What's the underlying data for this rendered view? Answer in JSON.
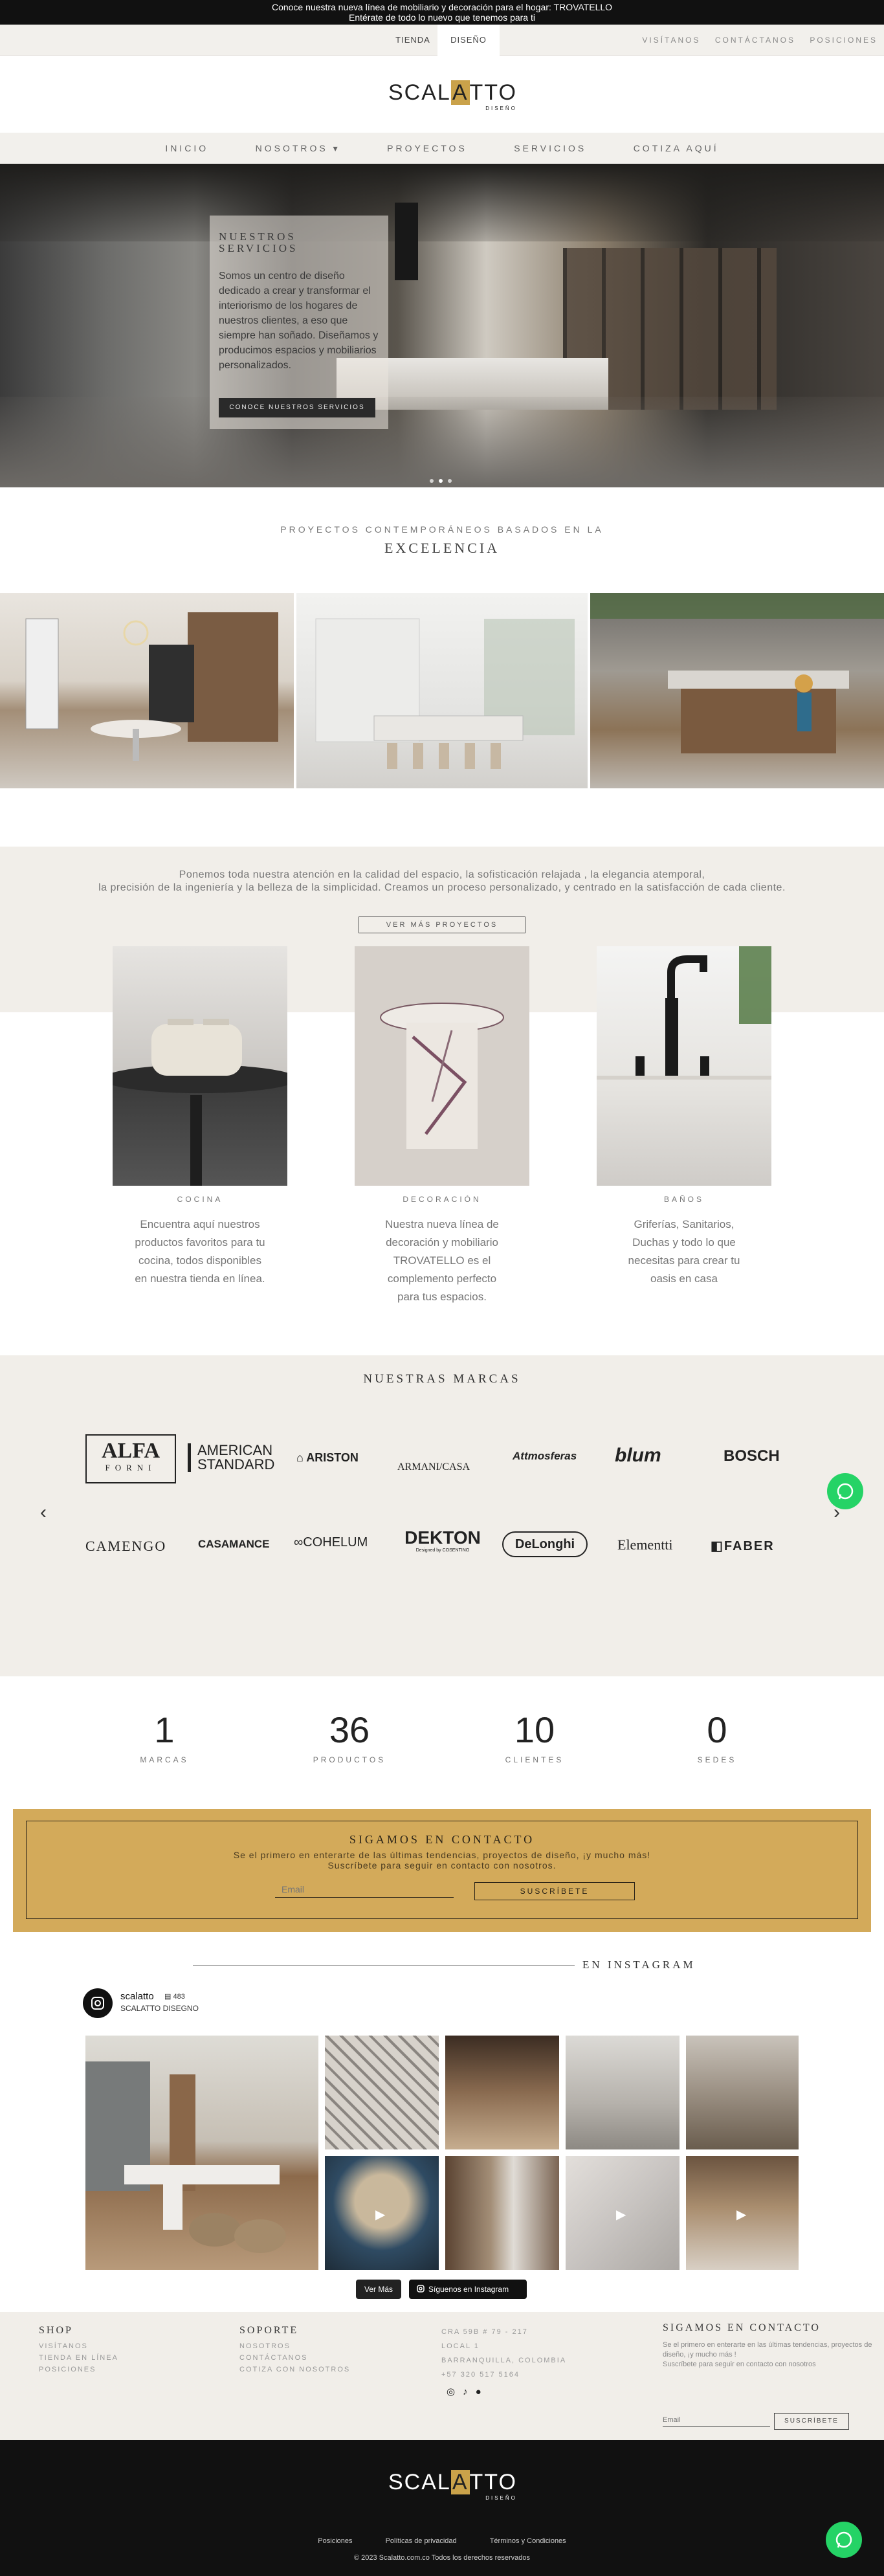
{
  "announcement": {
    "line1": "Conoce nuestra nueva línea de mobiliario y decoración para el hogar: TROVATELLO",
    "line2": "Entérate de todo lo nuevo que tenemos para ti"
  },
  "topbar": {
    "tabs": [
      "TIENDA",
      "DISEÑO"
    ],
    "links": [
      "VISÍTANOS",
      "CONTÁCTANOS",
      "POSICIONES"
    ]
  },
  "logo": {
    "text_before": "SCAL",
    "text_accent": "A",
    "text_after": "TTO",
    "sub": "DISEÑO"
  },
  "nav": [
    "INICIO",
    "NOSOTROS ▾",
    "PROYECTOS",
    "SERVICIOS",
    "COTIZA AQUÍ"
  ],
  "hero": {
    "title_line1": "NUESTROS",
    "title_line2": "SERVICIOS",
    "text": "Somos un centro de diseño dedicado a crear y transformar el interiorismo de los hogares de nuestros clientes, a eso que siempre han soñado. Diseñamos y producimos espacios y mobiliarios personalizados.",
    "button": "CONOCE NUESTROS SERVICIOS"
  },
  "projects_intro": {
    "subtitle": "PROYECTOS CONTEMPORÁNEOS BASADOS EN LA",
    "title": "EXCELENCIA"
  },
  "philosophy": {
    "line1": "Ponemos toda nuestra atención en la calidad del espacio, la sofisticación relajada , la elegancia atemporal,",
    "line2": "la precisión de la ingeniería y la belleza de la simplicidad. Creamos un proceso personalizado, y centrado en la satisfacción de cada cliente.",
    "button": "VER MÁS PROYECTOS"
  },
  "categories": [
    {
      "title": "COCINA",
      "text": "Encuentra aquí nuestros productos favoritos para tu cocina, todos disponibles en nuestra tienda en línea."
    },
    {
      "title": "DECORACIÓN",
      "text": "Nuestra nueva línea de decoración y mobiliario TROVATELLO es el complemento perfecto para tus espacios."
    },
    {
      "title": "BAÑOS",
      "text": "Griferías, Sanitarios, Duchas y todo lo que necesitas para crear tu oasis en casa"
    }
  ],
  "brands": {
    "title": "NUESTRAS MARCAS",
    "row1": [
      "ALFA",
      "FORNI",
      "AMERICAN",
      "STANDARD",
      "ARISTON",
      "ARMANI/CASA",
      "Attmosferas",
      "blum",
      "BOSCH"
    ],
    "row2": [
      "CAMENGO",
      "CASAMANCE",
      "COHELUM",
      "DEKTON",
      "Designed by COSENTINO",
      "DeLonghi",
      "Elementti",
      "FABER"
    ]
  },
  "stats": [
    {
      "num": "1",
      "label": "MARCAS"
    },
    {
      "num": "36",
      "label": "PRODUCTOS"
    },
    {
      "num": "10",
      "label": "CLIENTES"
    },
    {
      "num": "0",
      "label": "SEDES"
    }
  ],
  "contact": {
    "title": "SIGAMOS EN CONTACTO",
    "text1": "Se el primero en enterarte de las últimas tendencias, proyectos de diseño, ¡y mucho más!",
    "text2": "Suscríbete para seguir en contacto con nosotros.",
    "email_placeholder": "Email",
    "button": "SUSCRÍBETE"
  },
  "instagram": {
    "heading": "EN INSTAGRAM",
    "handle": "scalatto",
    "posts": "483",
    "name": "SCALATTO DISEGNO",
    "more_button": "Ver Más",
    "follow_button": "Síguenos en Instagram"
  },
  "footer": {
    "shop": {
      "title": "SHOP",
      "links": [
        "VISÍTANOS",
        "TIENDA EN LÍNEA",
        "POSICIONES"
      ]
    },
    "support": {
      "title": "SOPORTE",
      "links": [
        "NOSOTROS",
        "CONTÁCTANOS",
        "COTIZA CON NOSOTROS"
      ]
    },
    "address": [
      "CRA 59B # 79 - 217",
      "LOCAL 1",
      "BARRANQUILLA, COLOMBIA",
      "+57 320 517 5164"
    ],
    "contact": {
      "title": "SIGAMOS EN CONTACTO",
      "text1": "Se el primero en enterarte en las últimas tendencias, proyectos de",
      "text2": "diseño, ¡y mucho más !",
      "text3": "Suscríbete para seguir en contacto con nosotros",
      "email_placeholder": "Email",
      "button": "SUSCRÍBETE"
    },
    "bottom_links": [
      "Posiciones",
      "Políticas de privacidad",
      "Términos y Condiciones"
    ],
    "copyright": "© 2023 Scalatto.com.co Todos los derechos reservados"
  },
  "colors": {
    "gold": "#d3aa5a",
    "beige": "#f1eee9",
    "dark": "#111111",
    "whatsapp": "#25d366"
  }
}
